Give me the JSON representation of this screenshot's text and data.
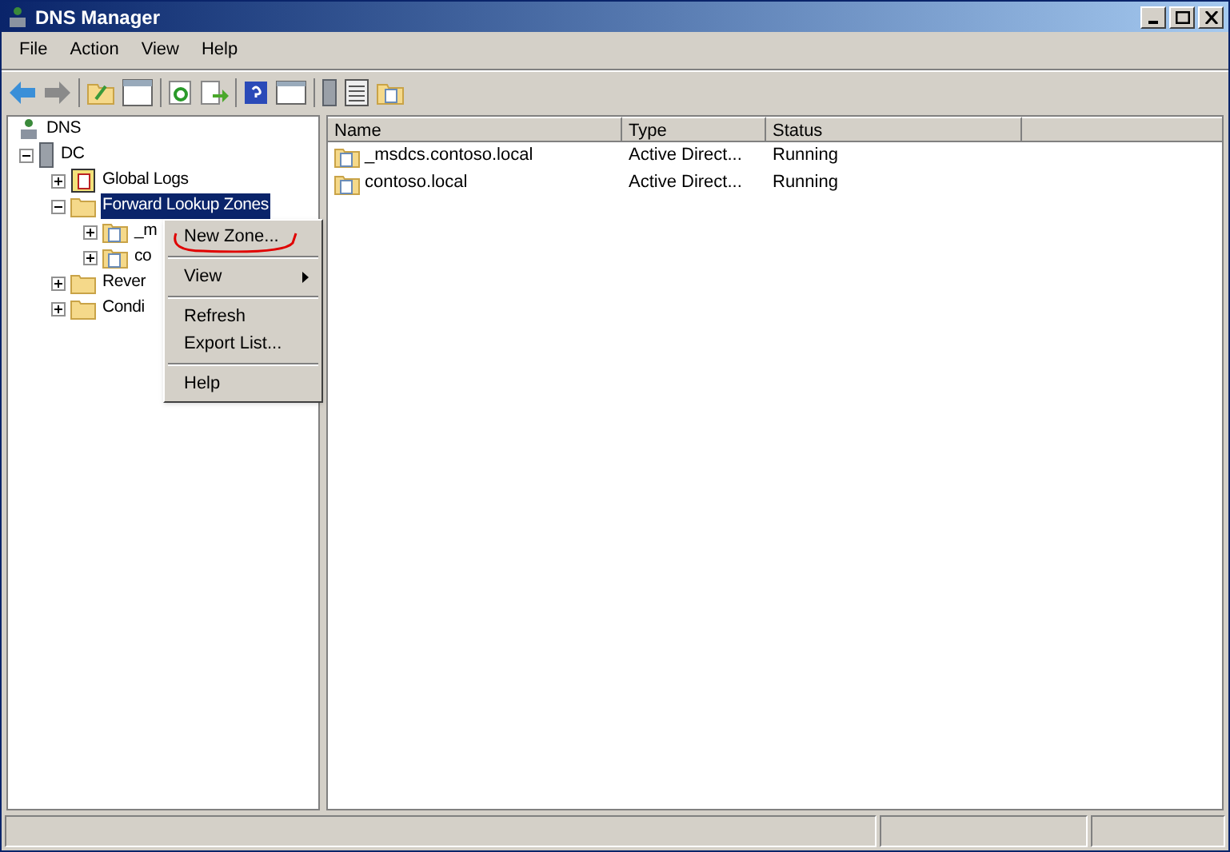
{
  "window": {
    "title": "DNS Manager"
  },
  "menu_bar": [
    "File",
    "Action",
    "View",
    "Help"
  ],
  "tree": [
    {
      "label": "DNS",
      "kind": "root",
      "children": [
        {
          "label": "DC",
          "kind": "server",
          "expanded": true,
          "selected": false,
          "children": [
            {
              "label": "Global Logs",
              "kind": "log",
              "expanded": false,
              "selected": false
            },
            {
              "label": "Forward Lookup Zones",
              "kind": "folder",
              "expanded": true,
              "selected": true,
              "children": [
                {
                  "label": "_m",
                  "kind": "zone",
                  "expanded": false,
                  "selected": false
                },
                {
                  "label": "co",
                  "kind": "zone",
                  "expanded": false,
                  "selected": false
                }
              ]
            },
            {
              "label": "Rever",
              "kind": "folder",
              "expanded": false,
              "selected": false
            },
            {
              "label": "Condi",
              "kind": "folder",
              "expanded": false,
              "selected": false
            }
          ]
        }
      ]
    }
  ],
  "context_menu": [
    {
      "label": "New Zone...",
      "kind": "item",
      "highlighted": true
    },
    {
      "kind": "separator"
    },
    {
      "label": "View",
      "kind": "submenu",
      "highlighted": false
    },
    {
      "kind": "separator"
    },
    {
      "label": "Refresh",
      "kind": "item",
      "highlighted": false
    },
    {
      "label": "Export List...",
      "kind": "item",
      "highlighted": false
    },
    {
      "kind": "separator"
    },
    {
      "label": "Help",
      "kind": "item",
      "highlighted": false
    }
  ],
  "table": {
    "columns": [
      "Name",
      "Type",
      "Status"
    ],
    "rows": [
      {
        "name": "_msdcs.contoso.local",
        "type": "Active Direct...",
        "status": "Running"
      },
      {
        "name": "contoso.local",
        "type": "Active Direct...",
        "status": "Running"
      }
    ]
  }
}
